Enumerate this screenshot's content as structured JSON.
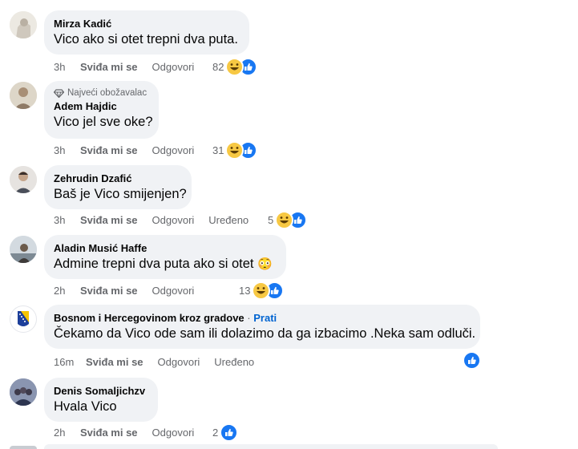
{
  "comments": [
    {
      "name": "Mirza Kadić",
      "badge": "",
      "follow": "",
      "text": "Vico ako si otet trepni dva puta.",
      "emoji": "",
      "time": "3h",
      "like": "Sviđa mi se",
      "reply": "Odgovori",
      "edited": "",
      "count": "82",
      "reactions": [
        "haha",
        "like"
      ]
    },
    {
      "name": "Adem Hajdic",
      "badge": "Najveći obožavalac",
      "follow": "",
      "text": "Vico jel sve oke?",
      "emoji": "",
      "time": "3h",
      "like": "Sviđa mi se",
      "reply": "Odgovori",
      "edited": "",
      "count": "31",
      "reactions": [
        "haha",
        "like"
      ]
    },
    {
      "name": "Zehrudin Dzafić",
      "badge": "",
      "follow": "",
      "text": "Baš je Vico smijenjen?",
      "emoji": "",
      "time": "3h",
      "like": "Sviđa mi se",
      "reply": "Odgovori",
      "edited": "Uređeno",
      "count": "5",
      "reactions": [
        "haha",
        "like"
      ]
    },
    {
      "name": "Aladin Musić Haffe",
      "badge": "",
      "follow": "",
      "text": "Admine trepni dva puta ako si otet",
      "emoji": "😳",
      "time": "2h",
      "like": "Sviđa mi se",
      "reply": "Odgovori",
      "edited": "",
      "count": "13",
      "reactions": [
        "haha",
        "like"
      ]
    },
    {
      "name": "Bosnom i Hercegovinom kroz gradove",
      "badge": "",
      "follow": "Prati",
      "text": "Čekamo da Vico ode sam ili dolazimo da ga izbacimo .Neka sam odluči.",
      "emoji": "",
      "time": "16m",
      "like": "Sviđa mi se",
      "reply": "Odgovori",
      "edited": "Uređeno",
      "count": "",
      "reactions": [
        "like"
      ]
    },
    {
      "name": "Denis Somaljichzv",
      "badge": "",
      "follow": "",
      "text": "Hvala Vico",
      "emoji": "",
      "time": "2h",
      "like": "Sviđa mi se",
      "reply": "Odgovori",
      "edited": "",
      "count": "2",
      "reactions": [
        "like"
      ]
    }
  ],
  "icons": {
    "badge": "diamond-icon",
    "haha": "haha-reaction-icon",
    "like": "like-reaction-icon"
  },
  "colors": {
    "bubble": "#f0f2f5",
    "meta": "#65676b",
    "link": "#0064d1",
    "like": "#1877f2",
    "haha": "#f7c843"
  }
}
